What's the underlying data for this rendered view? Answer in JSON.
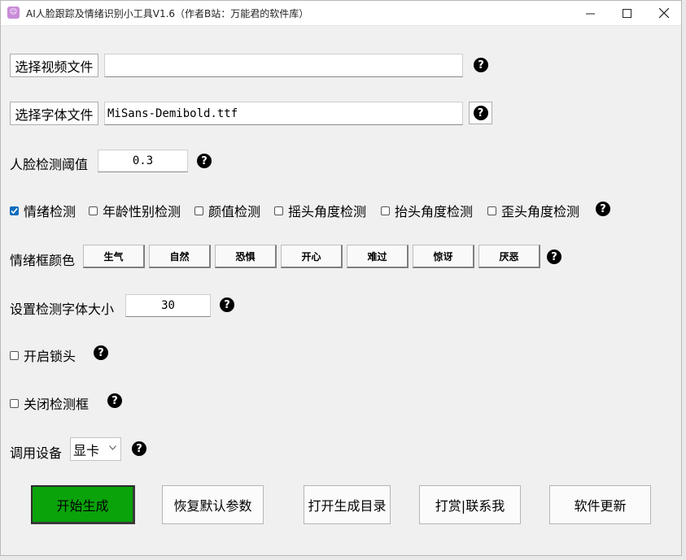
{
  "window": {
    "title": "AI人脸跟踪及情绪识别小工具V1.6（作者B站：万能君的软件库）",
    "app_icon": "app-logo-icon",
    "controls": [
      "minimize-icon",
      "maximize-icon",
      "close-icon"
    ]
  },
  "video": {
    "button_label": "选择视频文件",
    "path_value": "",
    "help": "?"
  },
  "font": {
    "button_label": "选择字体文件",
    "path_value": "MiSans-Demibold.ttf",
    "help": "?"
  },
  "threshold": {
    "label": "人脸检测阈值",
    "value": "0.3",
    "help": "?"
  },
  "detections": {
    "items": [
      {
        "label": "情绪检测",
        "checked": true
      },
      {
        "label": "年龄性别检测",
        "checked": false
      },
      {
        "label": "颜值检测",
        "checked": false
      },
      {
        "label": "摇头角度检测",
        "checked": false
      },
      {
        "label": "抬头角度检测",
        "checked": false
      },
      {
        "label": "歪头角度检测",
        "checked": false
      }
    ],
    "help": "?"
  },
  "emotion_colors": {
    "label": "情绪框颜色",
    "buttons": [
      "生气",
      "自然",
      "恐惧",
      "开心",
      "难过",
      "惊讶",
      "厌恶"
    ],
    "help": "?"
  },
  "font_size": {
    "label": "设置检测字体大小",
    "value": "30",
    "help": "?"
  },
  "lock_head": {
    "label": "开启锁头",
    "checked": false,
    "help": "?"
  },
  "close_box": {
    "label": "关闭检测框",
    "checked": false,
    "help": "?"
  },
  "device": {
    "label": "调用设备",
    "selected": "显卡",
    "help": "?"
  },
  "actions": {
    "start": "开始生成",
    "reset": "恢复默认参数",
    "open_dir": "打开生成目录",
    "donate": "打赏|联系我",
    "update": "软件更新"
  },
  "colors": {
    "start_button": "#0aa30a",
    "checkbox_checked": "#0f6cbd"
  }
}
